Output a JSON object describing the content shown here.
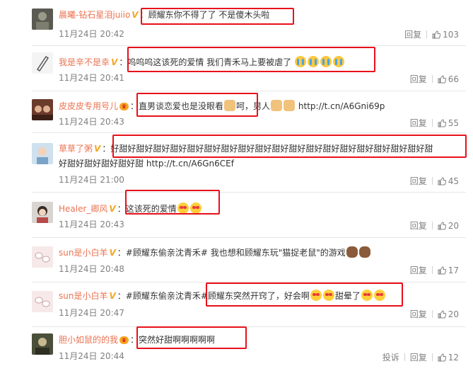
{
  "comments": [
    {
      "username": "晨曦-钻石星泪juiio",
      "badge": "V",
      "colon": "：",
      "content": "顾耀东你不得了了 不是傻木头啦",
      "time": "11月24日 20:42",
      "reply_label": "回复",
      "likes": "103"
    },
    {
      "username": "我是辛不是幸",
      "badge": "V",
      "colon": "：",
      "content": "呜呜呜这该死的爱情 我们青禾马上要被虐了",
      "time": "11月24日 20:41",
      "reply_label": "回复",
      "likes": "66"
    },
    {
      "username": "皮皮皮专用号儿",
      "badge": "♛",
      "colon": "：",
      "content_a": "直男谈恋爱也是没眼看",
      "content_b": "呵，男人",
      "link": "http://t.cn/A6Gni69p",
      "time": "11月24日 20:43",
      "reply_label": "回复",
      "likes": "55"
    },
    {
      "username": "草草了粥",
      "badge": "V",
      "colon": "：",
      "content_a": "好甜好甜好甜好甜好甜好甜好甜好甜好甜好甜好甜好甜好甜好甜好甜好甜好甜好甜好甜",
      "content_b": "好甜好甜好甜好甜好甜",
      "link": "http://t.cn/A6Gn6CEf",
      "time": "11月24日 21:00",
      "reply_label": "回复",
      "likes": "45"
    },
    {
      "username": "Healer_卿风",
      "badge": "V",
      "colon": "：",
      "content": "这该死的爱情",
      "time": "11月24日 20:43",
      "reply_label": "回复",
      "likes": "20"
    },
    {
      "username": "sun是小白羊",
      "badge": "V",
      "colon": "：",
      "topic": "#顾耀东偷亲沈青禾#",
      "content": "我也想和顾耀东玩\"猫捉老鼠\"的游戏",
      "time": "11月24日 20:48",
      "reply_label": "回复",
      "likes": "17"
    },
    {
      "username": "sun是小白羊",
      "badge": "V",
      "colon": "：",
      "topic": "#顾耀东偷亲沈青禾#",
      "content_a": "顾耀东突然开窍了，好会啊",
      "content_b": "甜晕了",
      "time": "11月24日 20:47",
      "reply_label": "回复",
      "likes": "20"
    },
    {
      "username": "胆小如鼠的的我",
      "badge": "♛",
      "colon": "：",
      "content": "突然好甜啊啊啊啊啊",
      "time": "11月24日 20:44",
      "report_label": "投诉",
      "reply_label": "回复",
      "likes": "12"
    }
  ],
  "colors": {
    "username": "#eb7350",
    "highlight_box": "#e8101a",
    "meta": "#808080"
  }
}
